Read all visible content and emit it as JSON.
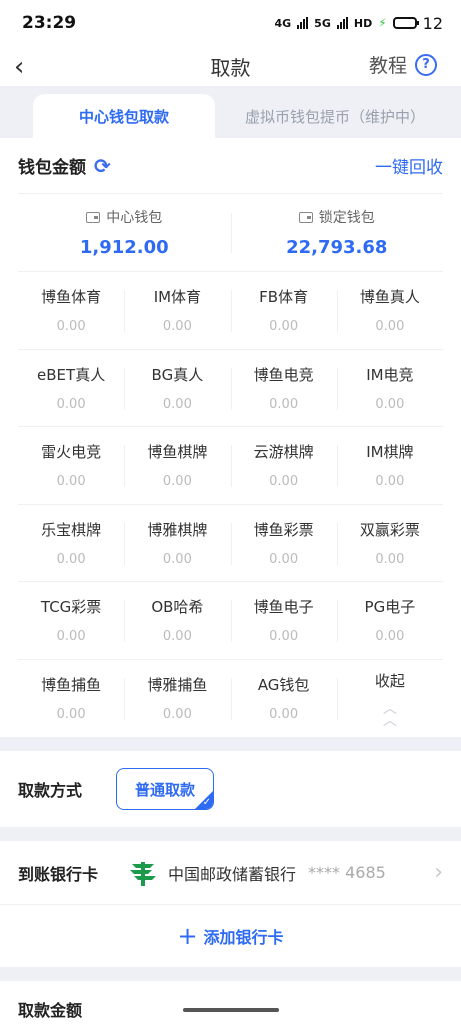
{
  "status": {
    "time": "23:29",
    "net1": "4G",
    "net2": "5G",
    "hd": "HD",
    "battery": "12"
  },
  "nav": {
    "title": "取款",
    "help_label": "教程",
    "help_icon": "?"
  },
  "tabs": [
    {
      "label": "中心钱包取款",
      "active": true
    },
    {
      "label": "虚拟币钱包提币（维护中）",
      "active": false
    }
  ],
  "wallet": {
    "title": "钱包金额",
    "recycle_label": "一键回收",
    "center": {
      "name": "中心钱包",
      "amount": "1,912.00"
    },
    "locked": {
      "name": "锁定钱包",
      "amount": "22,793.68"
    }
  },
  "platforms": [
    {
      "name": "博鱼体育",
      "value": "0.00"
    },
    {
      "name": "IM体育",
      "value": "0.00"
    },
    {
      "name": "FB体育",
      "value": "0.00"
    },
    {
      "name": "博鱼真人",
      "value": "0.00"
    },
    {
      "name": "eBET真人",
      "value": "0.00"
    },
    {
      "name": "BG真人",
      "value": "0.00"
    },
    {
      "name": "博鱼电竞",
      "value": "0.00"
    },
    {
      "name": "IM电竞",
      "value": "0.00"
    },
    {
      "name": "雷火电竞",
      "value": "0.00"
    },
    {
      "name": "博鱼棋牌",
      "value": "0.00"
    },
    {
      "name": "云游棋牌",
      "value": "0.00"
    },
    {
      "name": "IM棋牌",
      "value": "0.00"
    },
    {
      "name": "乐宝棋牌",
      "value": "0.00"
    },
    {
      "name": "博雅棋牌",
      "value": "0.00"
    },
    {
      "name": "博鱼彩票",
      "value": "0.00"
    },
    {
      "name": "双赢彩票",
      "value": "0.00"
    },
    {
      "name": "TCG彩票",
      "value": "0.00"
    },
    {
      "name": "OB哈希",
      "value": "0.00"
    },
    {
      "name": "博鱼电子",
      "value": "0.00"
    },
    {
      "name": "PG电子",
      "value": "0.00"
    },
    {
      "name": "博鱼捕鱼",
      "value": "0.00"
    },
    {
      "name": "博雅捕鱼",
      "value": "0.00"
    },
    {
      "name": "AG钱包",
      "value": "0.00"
    }
  ],
  "collapse_label": "收起",
  "method": {
    "label": "取款方式",
    "option": "普通取款"
  },
  "bank": {
    "label": "到账银行卡",
    "name": "中国邮政储蓄银行",
    "number": "**** 4685",
    "add_label": "添加银行卡",
    "logo_color": "#1a9a4a"
  },
  "amount": {
    "label": "取款金额"
  },
  "colors": {
    "accent": "#2f6bf2",
    "background": "#eef0f5"
  }
}
